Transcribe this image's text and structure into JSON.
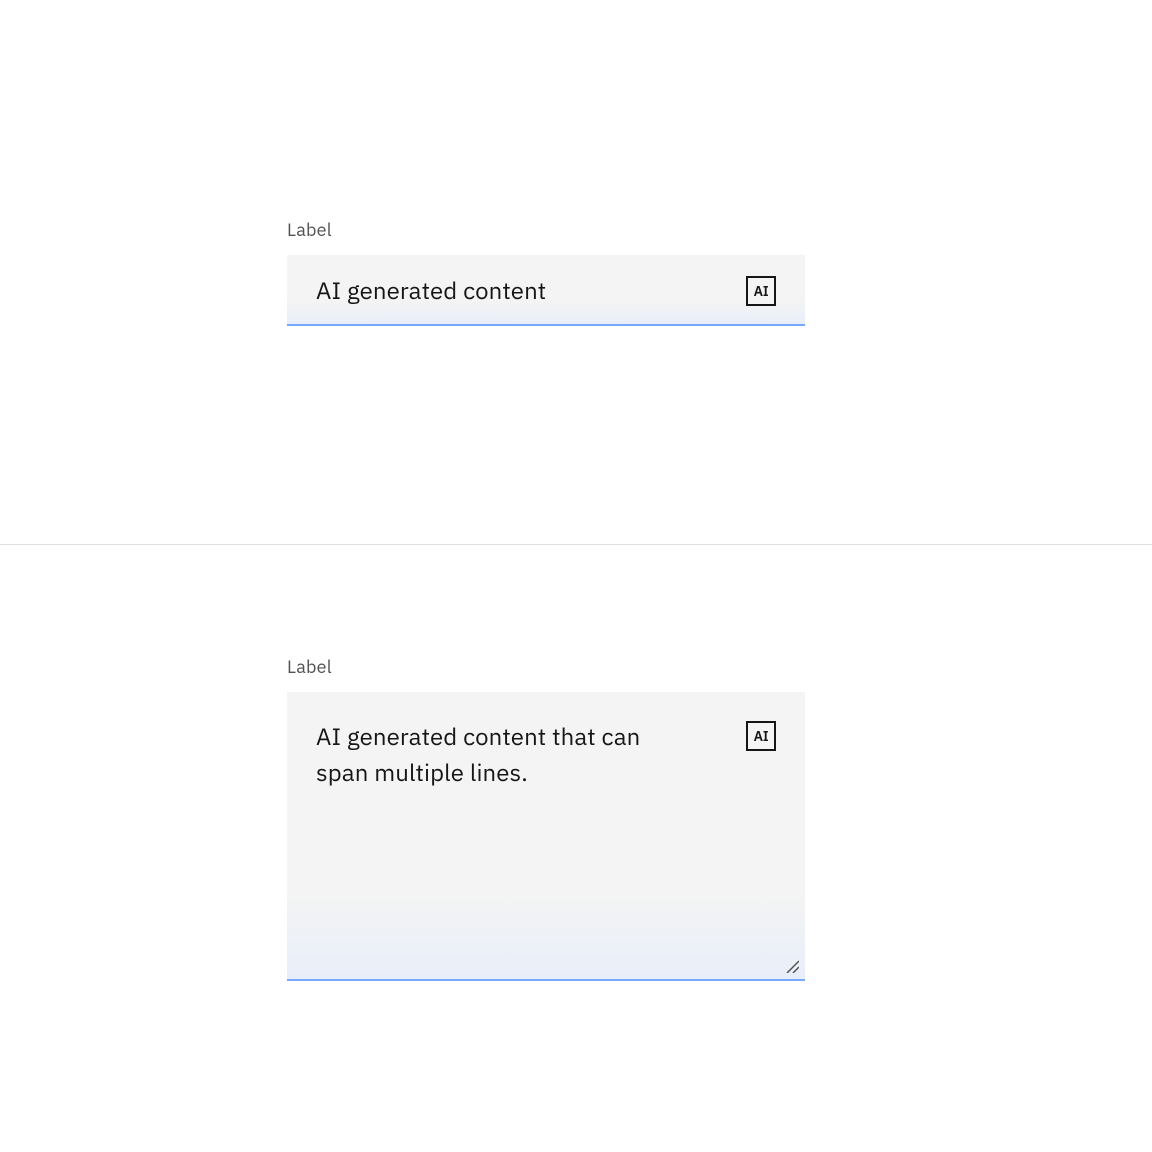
{
  "textInput": {
    "label": "Label",
    "value": "AI generated content",
    "aiBadge": "AI"
  },
  "textArea": {
    "label": "Label",
    "value": "AI generated content that can span multiple lines.",
    "aiBadge": "AI"
  }
}
